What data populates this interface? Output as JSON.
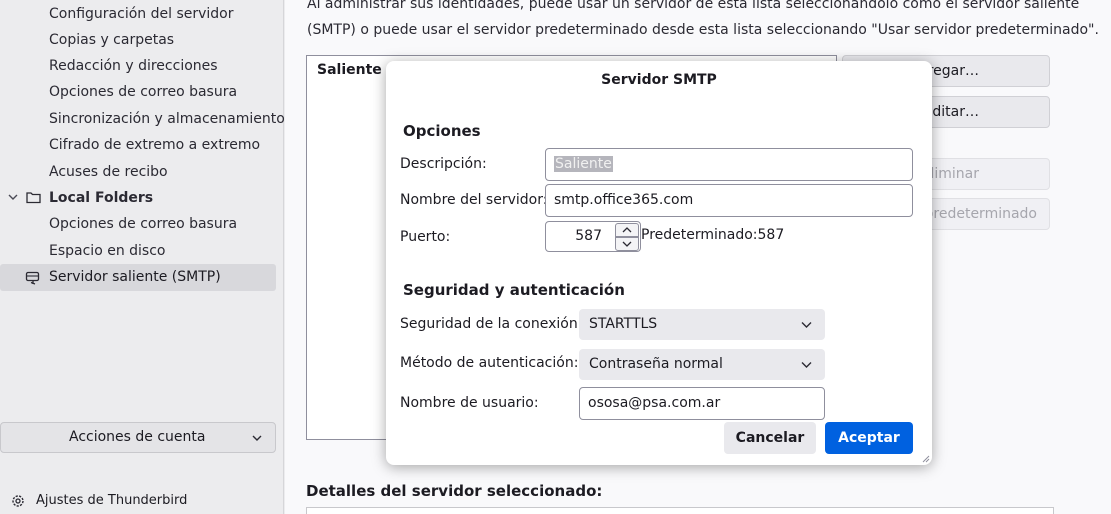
{
  "sidebar": {
    "items": [
      {
        "label": "Configuración del servidor"
      },
      {
        "label": "Copias y carpetas"
      },
      {
        "label": "Redacción y direcciones"
      },
      {
        "label": "Opciones de correo basura"
      },
      {
        "label": "Sincronización y almacenamiento"
      },
      {
        "label": "Cifrado de extremo a extremo"
      },
      {
        "label": "Acuses de recibo"
      }
    ],
    "local_folders": {
      "label": "Local Folders",
      "items": [
        {
          "label": "Opciones de correo basura"
        },
        {
          "label": "Espacio en disco"
        }
      ]
    },
    "selected_item": "Servidor saliente (SMTP)",
    "account_actions": "Acciones de cuenta",
    "settings_link": "Ajustes de Thunderbird"
  },
  "main": {
    "intro_line1": "Al administrar sus identidades, puede usar un servidor de esta lista seleccionándolo como el servidor saliente",
    "intro_line2": "(SMTP) o puede usar el servidor predeterminado desde esta lista seleccionando \"Usar servidor predeterminado\".",
    "list_row": "Saliente -",
    "buttons": {
      "add": "Agregar…",
      "edit": "Editar…",
      "remove": "Eliminar",
      "set_default": "Establecer predeterminado"
    },
    "details_title": "Detalles del servidor seleccionado:"
  },
  "dialog": {
    "title": "Servidor SMTP",
    "options_section": "Opciones",
    "description_label": "Descripción:",
    "description_value": "Saliente",
    "server_name_label": "Nombre del servidor:",
    "server_name_value": "smtp.office365.com",
    "port_label": "Puerto:",
    "port_value": "587",
    "port_default_note": "Predeterminado:587",
    "security_section": "Seguridad y autenticación",
    "connection_security_label": "Seguridad de la conexión:",
    "connection_security_value": "STARTTLS",
    "auth_method_label": "Método de autenticación:",
    "auth_method_value": "Contraseña normal",
    "username_label": "Nombre de usuario:",
    "username_value": "ososa@psa.com.ar",
    "cancel_label": "Cancelar",
    "accept_label": "Aceptar"
  },
  "colors": {
    "accent": "#0061e0",
    "sidebar_bg": "#ececee",
    "selected_bg": "#d8d8dc",
    "dialog_bg": "#ffffff"
  }
}
